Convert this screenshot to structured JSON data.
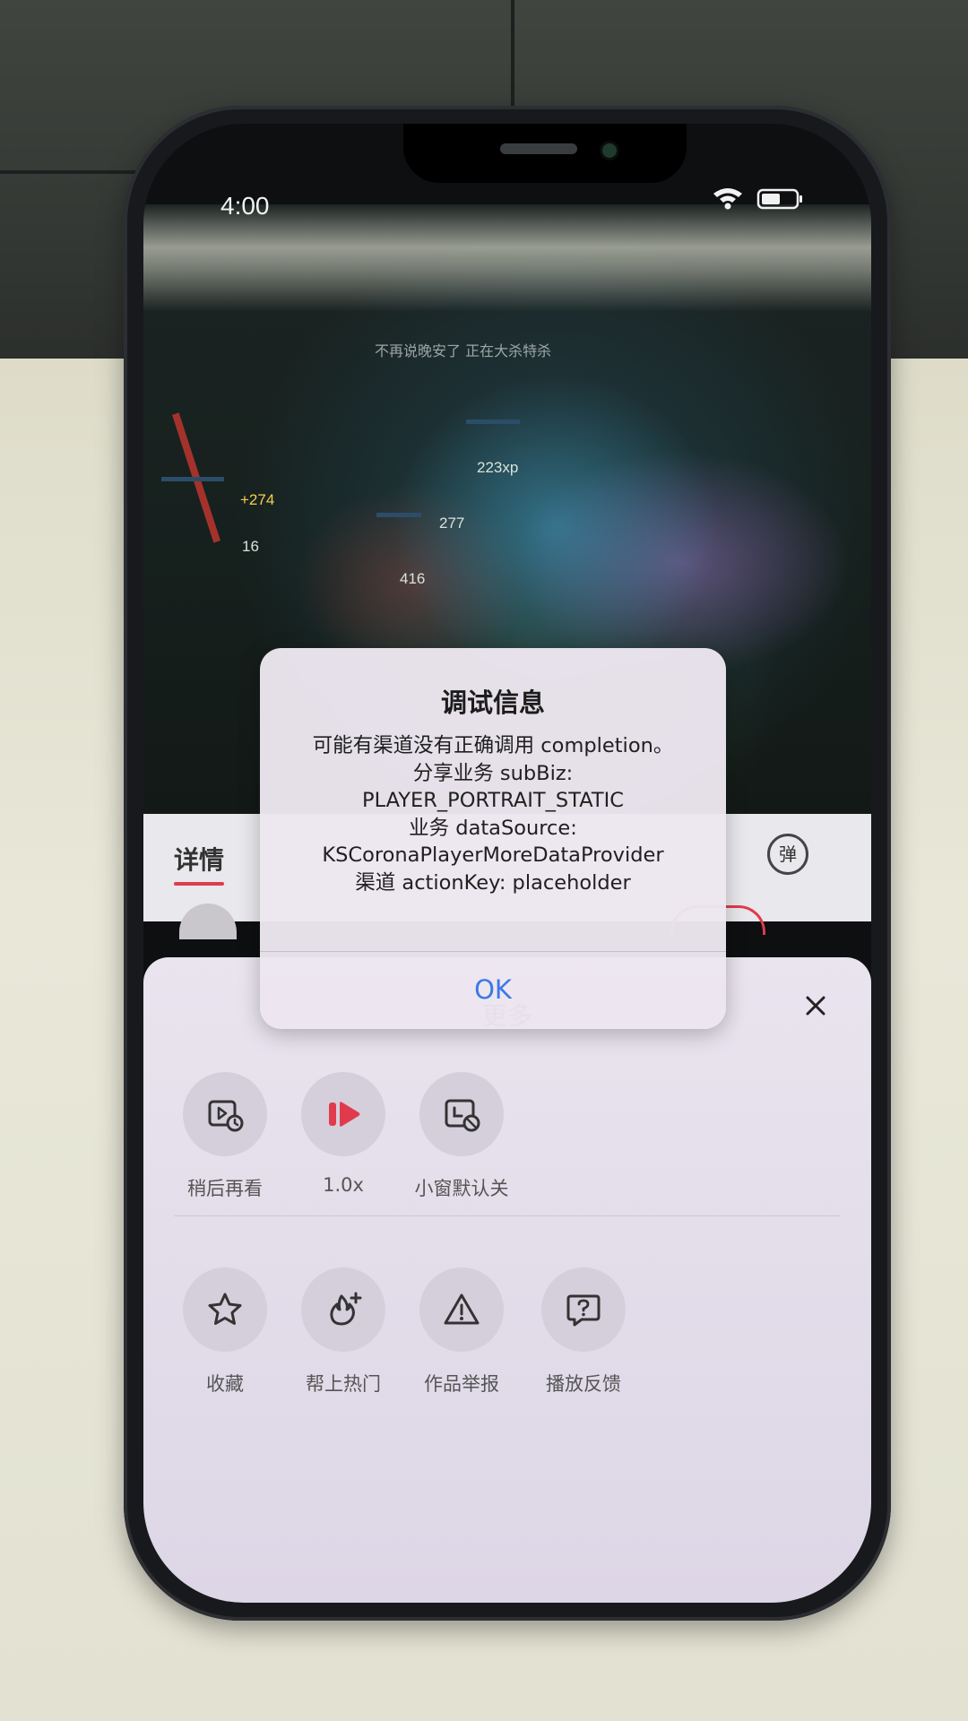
{
  "status_bar": {
    "time": "4:00"
  },
  "video": {
    "top_text": "不再说晚安了 正在大杀特杀",
    "hud_numbers": [
      "+274",
      "16",
      "277",
      "416",
      "223xp"
    ]
  },
  "detail": {
    "tab_label": "详情",
    "danmaku_label": "弹"
  },
  "alert": {
    "title": "调试信息",
    "lines": [
      "可能有渠道没有正确调用 completion。",
      "分享业务 subBiz:",
      "PLAYER_PORTRAIT_STATIC",
      "业务 dataSource:",
      "KSCoronaPlayerMoreDataProvider",
      "渠道 actionKey: placeholder"
    ],
    "ok_label": "OK"
  },
  "sheet": {
    "title": "更多",
    "row1": [
      {
        "label": "稍后再看",
        "icon": "watch-later-icon"
      },
      {
        "label": "1.0x",
        "icon": "playback-speed-icon"
      },
      {
        "label": "小窗默认关",
        "icon": "mini-window-off-icon"
      }
    ],
    "row2": [
      {
        "label": "收藏",
        "icon": "star-icon"
      },
      {
        "label": "帮上热门",
        "icon": "boost-icon"
      },
      {
        "label": "作品举报",
        "icon": "warning-icon"
      },
      {
        "label": "播放反馈",
        "icon": "question-bubble-icon"
      }
    ]
  },
  "colors": {
    "accent": "#e03b4d",
    "link_blue": "#3b79e6"
  }
}
